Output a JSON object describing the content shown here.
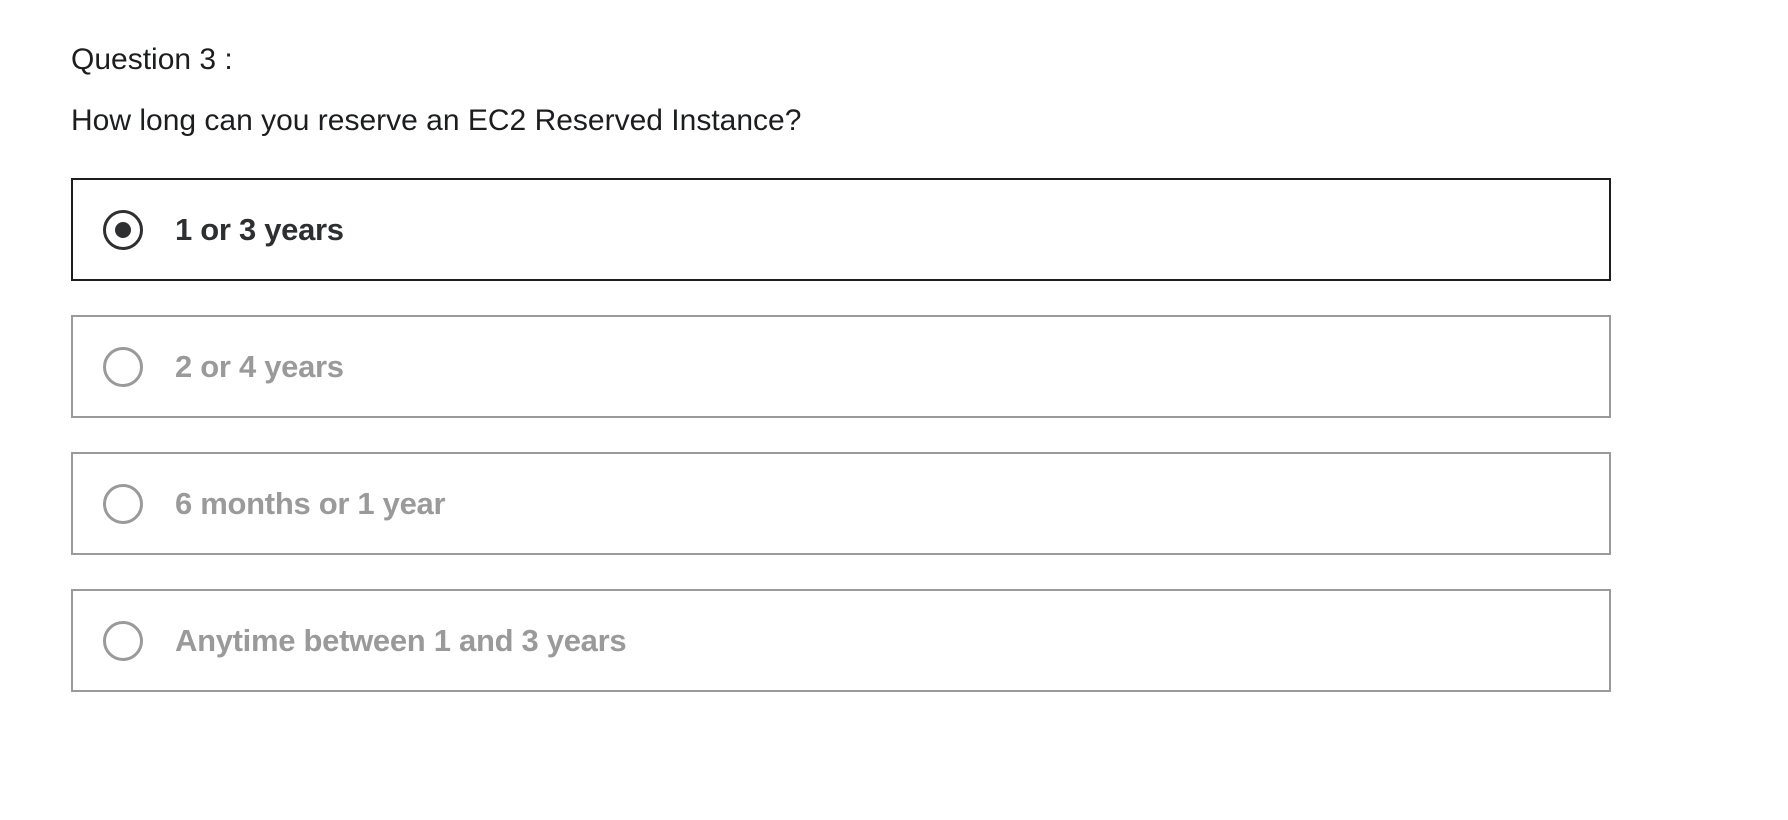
{
  "question": {
    "number_label": "Question 3 :",
    "text": "How long can you reserve an EC2 Reserved Instance?"
  },
  "options": [
    {
      "label": "1 or 3 years",
      "selected": true
    },
    {
      "label": "2 or 4 years",
      "selected": false
    },
    {
      "label": "6 months or 1 year",
      "selected": false
    },
    {
      "label": "Anytime between 1 and 3 years",
      "selected": false
    }
  ],
  "colors": {
    "text_primary": "#1c1d1f",
    "selected_border": "#1c1d1f",
    "unselected": "#9a9a9a"
  }
}
